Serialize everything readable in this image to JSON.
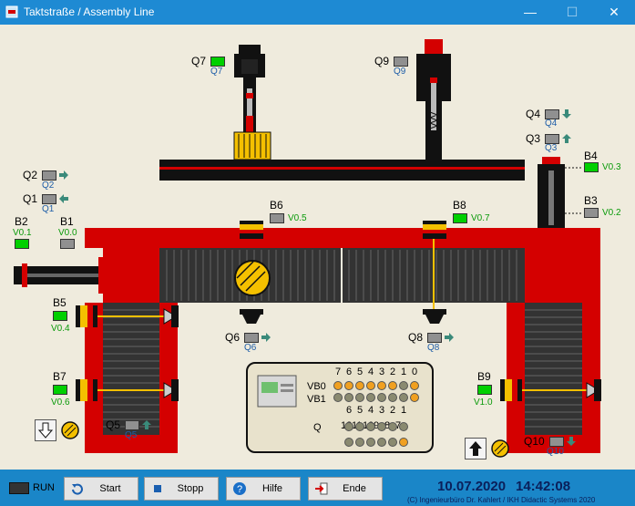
{
  "window": {
    "title": "Taktstraße / Assembly Line"
  },
  "labels": {
    "Q7": "Q7",
    "Q9": "Q9",
    "Q4": "Q4",
    "Q3": "Q3",
    "Q2": "Q2",
    "Q1": "Q1",
    "B4": "B4",
    "B3": "B3",
    "B2": "B2",
    "B1": "B1",
    "B6": "B6",
    "B8": "B8",
    "B5": "B5",
    "B7": "B7",
    "B9": "B9",
    "Q6": "Q6",
    "Q8": "Q8",
    "Q5": "Q5",
    "Q10": "Q10"
  },
  "variables": {
    "B4": "V0.3",
    "B3": "V0.2",
    "B2": "V0.1",
    "B1": "V0.0",
    "B6": "V0.5",
    "B8": "V0.7",
    "B5": "V0.4",
    "B7": "V0.6",
    "B9": "V1.0"
  },
  "plc": {
    "vb0": "VB0",
    "vb1": "VB1",
    "q": "Q",
    "top_bits": [
      "7",
      "6",
      "5",
      "4",
      "3",
      "2",
      "1",
      "0"
    ],
    "q_row1": [
      "6",
      "5",
      "4",
      "3",
      "2",
      "1"
    ],
    "q_row2": [
      "12",
      "11",
      "10",
      "9",
      "8",
      "7"
    ]
  },
  "status": {
    "run": "RUN",
    "start": "Start",
    "stop": "Stopp",
    "help": "Hilfe",
    "end": "Ende",
    "date": "10.07.2020",
    "time": "14:42:08",
    "copyright": "(C) Ingenieurbüro Dr. Kahlert / IKH Didactic Systems 2020"
  },
  "colors": {
    "frame_red": "#d40000",
    "led_on": "#00d000",
    "led_off": "#909090",
    "accent_yellow": "#f4c000",
    "titlebar": "#1e8ad3"
  }
}
